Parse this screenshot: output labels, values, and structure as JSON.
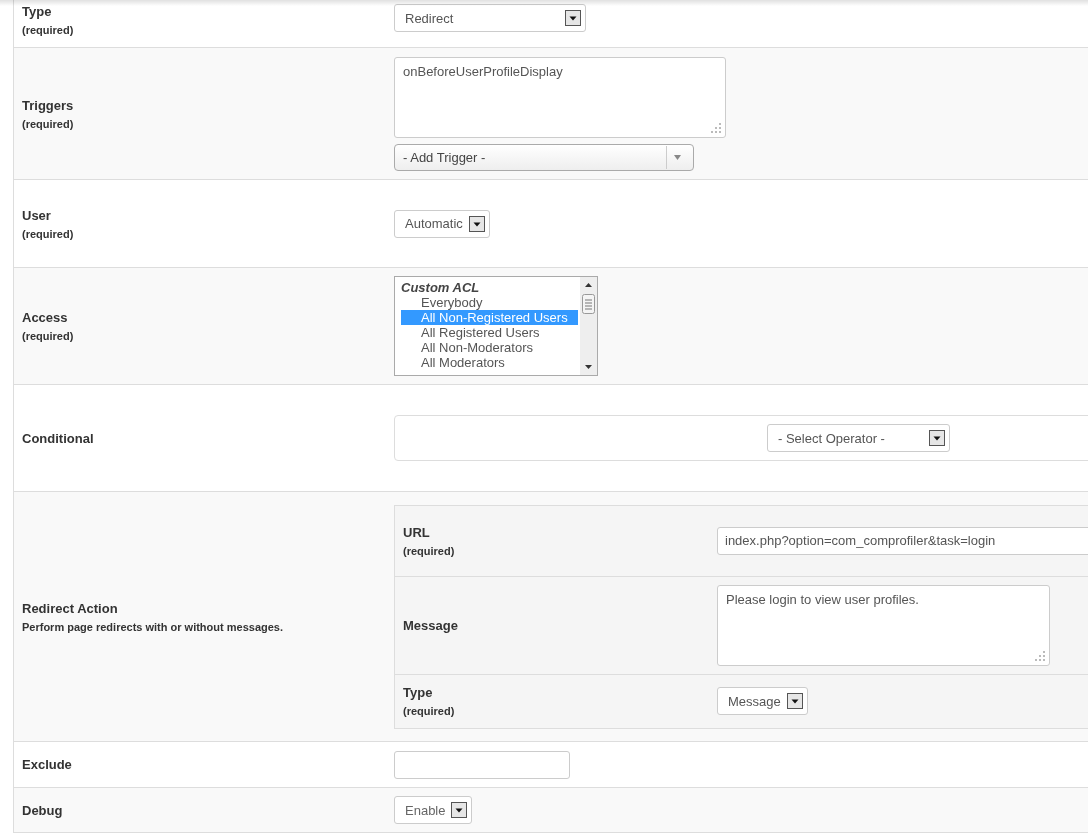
{
  "fields": [
    {
      "kind": "select",
      "label": "Type",
      "required": "(required)",
      "value": "Redirect"
    },
    {
      "kind": "triggers",
      "label": "Triggers",
      "required": "(required)",
      "value": "onBeforeUserProfileDisplay",
      "add": "- Add Trigger -"
    },
    {
      "kind": "select",
      "label": "User",
      "required": "(required)",
      "value": "Automatic"
    },
    {
      "kind": "listbox",
      "label": "Access",
      "required": "(required)",
      "groups": [
        {
          "label": "Custom ACL",
          "options": [
            {
              "label": "Everybody",
              "selected": false
            },
            {
              "label": "All Non-Registered Users",
              "selected": true
            },
            {
              "label": "All Registered Users",
              "selected": false
            },
            {
              "label": "All Non-Moderators",
              "selected": false
            },
            {
              "label": "All Moderators",
              "selected": false
            }
          ]
        }
      ]
    },
    {
      "kind": "conditional",
      "label": "Conditional",
      "operator": "- Select Operator -"
    },
    {
      "kind": "subform",
      "label": "Redirect Action",
      "description": "Perform page redirects with or without messages.",
      "fields": [
        {
          "kind": "text",
          "label": "URL",
          "required": "(required)",
          "value": "index.php?option=com_comprofiler&task=login"
        },
        {
          "kind": "textarea",
          "label": "Message",
          "value": "Please login to view user profiles."
        },
        {
          "kind": "select",
          "label": "Type",
          "required": "(required)",
          "value": "Message"
        }
      ]
    },
    {
      "kind": "text",
      "label": "Exclude"
    },
    {
      "kind": "select",
      "label": "Debug",
      "value": "Enable"
    }
  ]
}
